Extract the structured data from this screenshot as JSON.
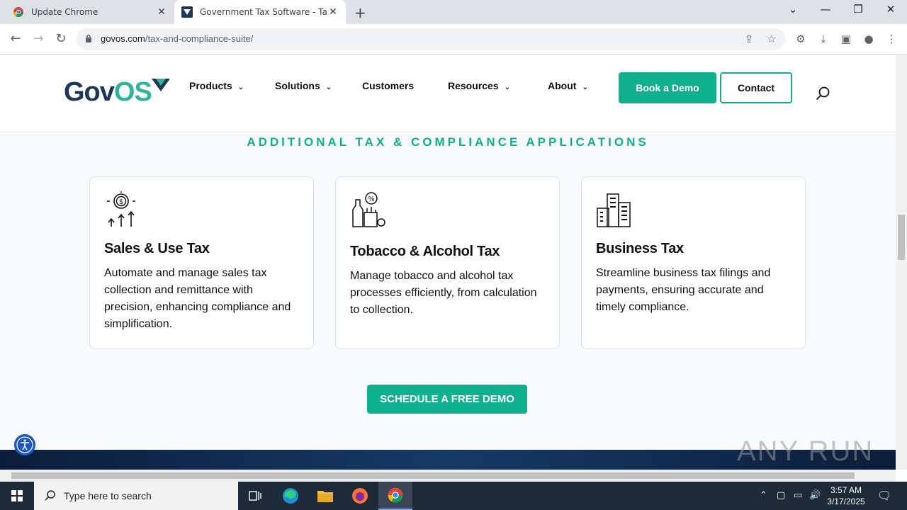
{
  "browser": {
    "tabs": [
      {
        "title": "Update Chrome"
      },
      {
        "title": "Government Tax Software - Tax & Compliance Suite"
      }
    ],
    "url_host": "govos.com",
    "url_path": "/tax-and-compliance-suite/"
  },
  "site": {
    "logo_gov": "Gov",
    "logo_os": "OS",
    "nav": [
      {
        "label": "Products"
      },
      {
        "label": "Solutions"
      },
      {
        "label": "Customers"
      },
      {
        "label": "Resources"
      },
      {
        "label": "About"
      }
    ],
    "book_demo": "Book a Demo",
    "contact": "Contact"
  },
  "section": {
    "title": "ADDITIONAL TAX & COMPLIANCE APPLICATIONS",
    "cards": [
      {
        "icon": "money-growth-icon",
        "title": "Sales & Use Tax",
        "desc": "Automate and manage sales tax collection and remittance with precision, enhancing compliance and simplification."
      },
      {
        "icon": "tobacco-alcohol-icon",
        "title": "Tobacco & Alcohol Tax",
        "desc": "Manage tobacco and alcohol tax processes efficiently, from calculation to collection."
      },
      {
        "icon": "city-buildings-icon",
        "title": "Business Tax",
        "desc": "Streamline business tax filings and payments, ensuring accurate and timely compliance."
      }
    ],
    "cta": "SCHEDULE A FREE DEMO"
  },
  "watermark": "ANY RUN",
  "taskbar": {
    "search_placeholder": "Type here to search",
    "time": "3:57 AM",
    "date": "3/17/2025"
  },
  "colors": {
    "brand_green": "#0fb08d",
    "brand_navy": "#1d3557"
  }
}
